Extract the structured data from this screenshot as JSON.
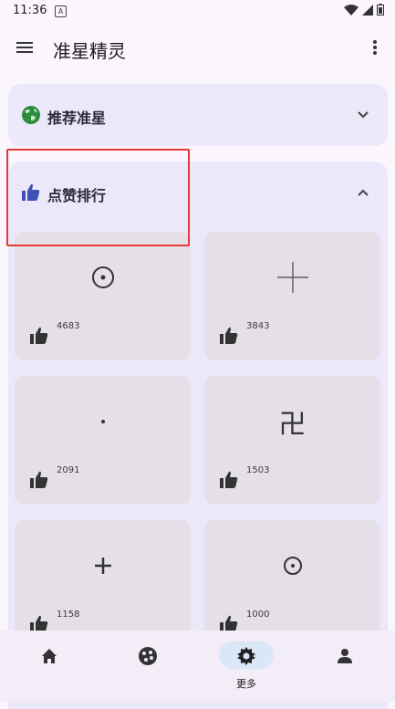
{
  "status": {
    "time": "11:36",
    "notification_letter": "A"
  },
  "app": {
    "title": "准星精灵"
  },
  "sections": {
    "recommend": {
      "title": "推荐准星",
      "icon": "globe-icon",
      "expanded": false
    },
    "likes": {
      "title": "点赞排行",
      "icon": "thumbs-up-icon",
      "expanded": true
    }
  },
  "crosshairs": [
    {
      "symbol": "circle-dot",
      "likes": "4683"
    },
    {
      "symbol": "thin-cross",
      "likes": "3843"
    },
    {
      "symbol": "dot",
      "likes": "2091"
    },
    {
      "symbol": "manji-glyph",
      "glyph": "卍",
      "likes": "1503"
    },
    {
      "symbol": "plus",
      "likes": "1158"
    },
    {
      "symbol": "circle-dot",
      "likes": "1000"
    }
  ],
  "bottom_nav": {
    "items": [
      {
        "icon": "home-icon",
        "label": ""
      },
      {
        "icon": "palette-icon",
        "label": ""
      },
      {
        "icon": "gear-icon",
        "label": "更多",
        "active": true
      },
      {
        "icon": "person-icon",
        "label": ""
      }
    ]
  },
  "colors": {
    "accent": "#3f51b5",
    "highlight": "#e53935",
    "globe": "#2e8b3e"
  }
}
